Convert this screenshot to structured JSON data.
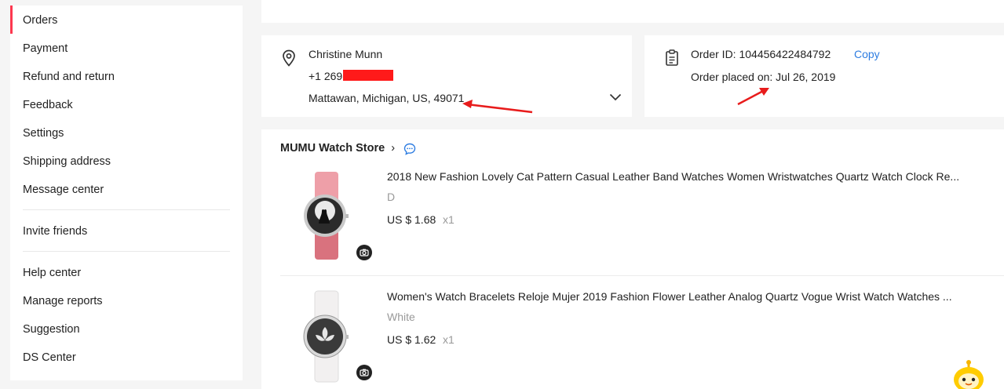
{
  "sidebar": {
    "items": [
      {
        "label": "Orders",
        "active": true
      },
      {
        "label": "Payment"
      },
      {
        "label": "Refund and return"
      },
      {
        "label": "Feedback"
      },
      {
        "label": "Settings"
      },
      {
        "label": "Shipping address"
      },
      {
        "label": "Message center"
      },
      {
        "label": "Invite friends"
      },
      {
        "label": "Help center"
      },
      {
        "label": "Manage reports"
      },
      {
        "label": "Suggestion"
      },
      {
        "label": "DS Center"
      }
    ]
  },
  "address": {
    "icon": "location-pin-icon",
    "name": "Christine Munn",
    "phone": "+1 269-5",
    "location": "Mattawan, Michigan, US, 49071",
    "expand_icon": "chevron-down-icon"
  },
  "order": {
    "icon": "clipboard-icon",
    "id_text": "Order ID: 104456422484792",
    "copy_label": "Copy",
    "placed_text": "Order placed on: Jul 26, 2019"
  },
  "store": {
    "name": "MUMU Watch Store",
    "chevron": "›",
    "chat_icon": "chat-bubble-icon",
    "products": [
      {
        "title": "2018 New Fashion Lovely Cat Pattern Casual Leather Band Watches Women Wristwatches Quartz Watch Clock Re...",
        "variant": "D",
        "price": "US $ 1.68",
        "qty": "x1"
      },
      {
        "title": "Women's Watch Bracelets Reloje Mujer 2019 Fashion Flower Leather Analog Quartz Vogue Wrist Watch Watches ...",
        "variant": "White",
        "price": "US $ 1.62",
        "qty": "x1"
      }
    ]
  },
  "colors": {
    "accent": "#fd384f",
    "link": "#2e7de1",
    "annotation": "#e81c1c"
  }
}
